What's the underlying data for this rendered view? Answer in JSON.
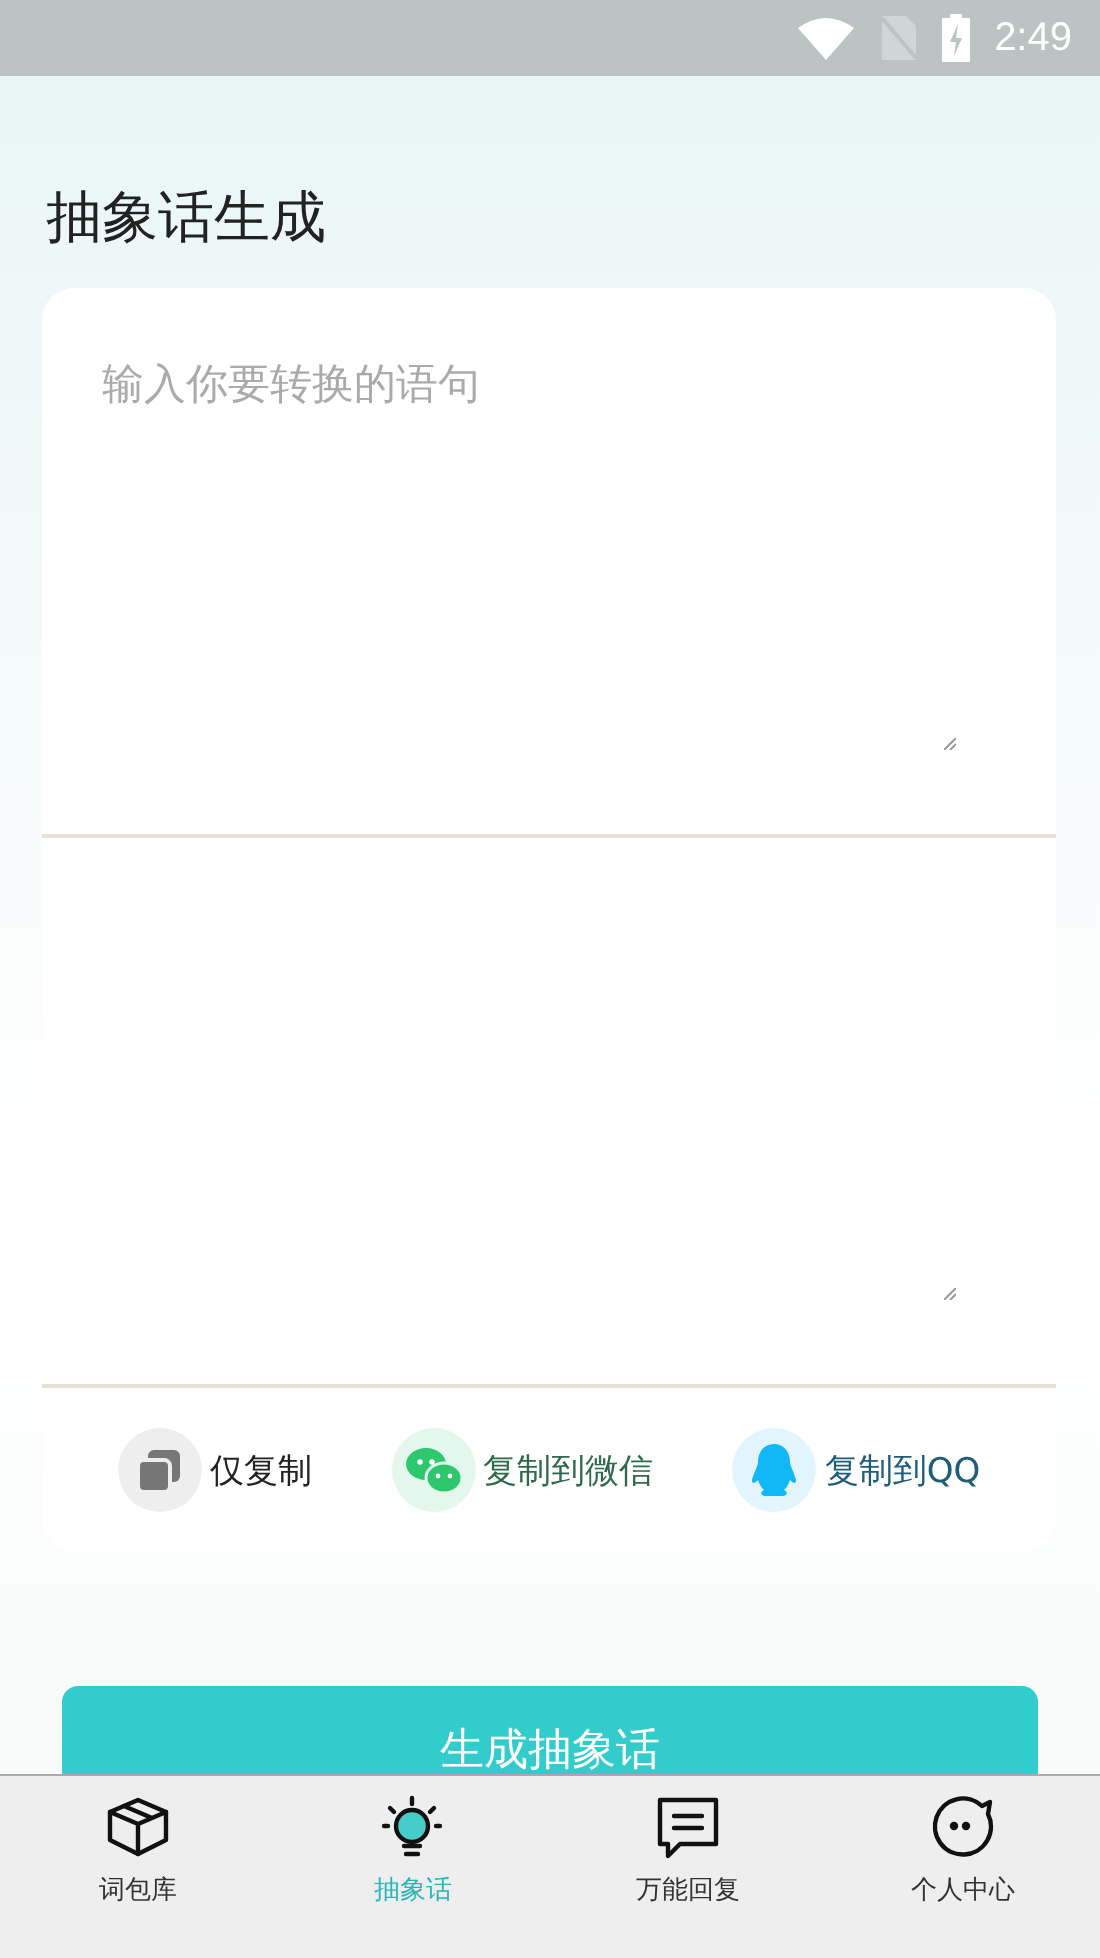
{
  "status_bar": {
    "time": "2:49"
  },
  "title": "抽象话生成",
  "input": {
    "placeholder": "输入你要转换的语句"
  },
  "actions": [
    {
      "kind": "copy",
      "label": "仅复制"
    },
    {
      "kind": "wechat",
      "label": "复制到微信"
    },
    {
      "kind": "qq",
      "label": "复制到QQ"
    }
  ],
  "generate_button": "生成抽象话",
  "tabs": [
    {
      "kind": "box",
      "label": "词包库",
      "selected": false
    },
    {
      "kind": "bulb",
      "label": "抽象话",
      "selected": true
    },
    {
      "kind": "chat",
      "label": "万能回复",
      "selected": false
    },
    {
      "kind": "face",
      "label": "个人中心",
      "selected": false
    }
  ]
}
